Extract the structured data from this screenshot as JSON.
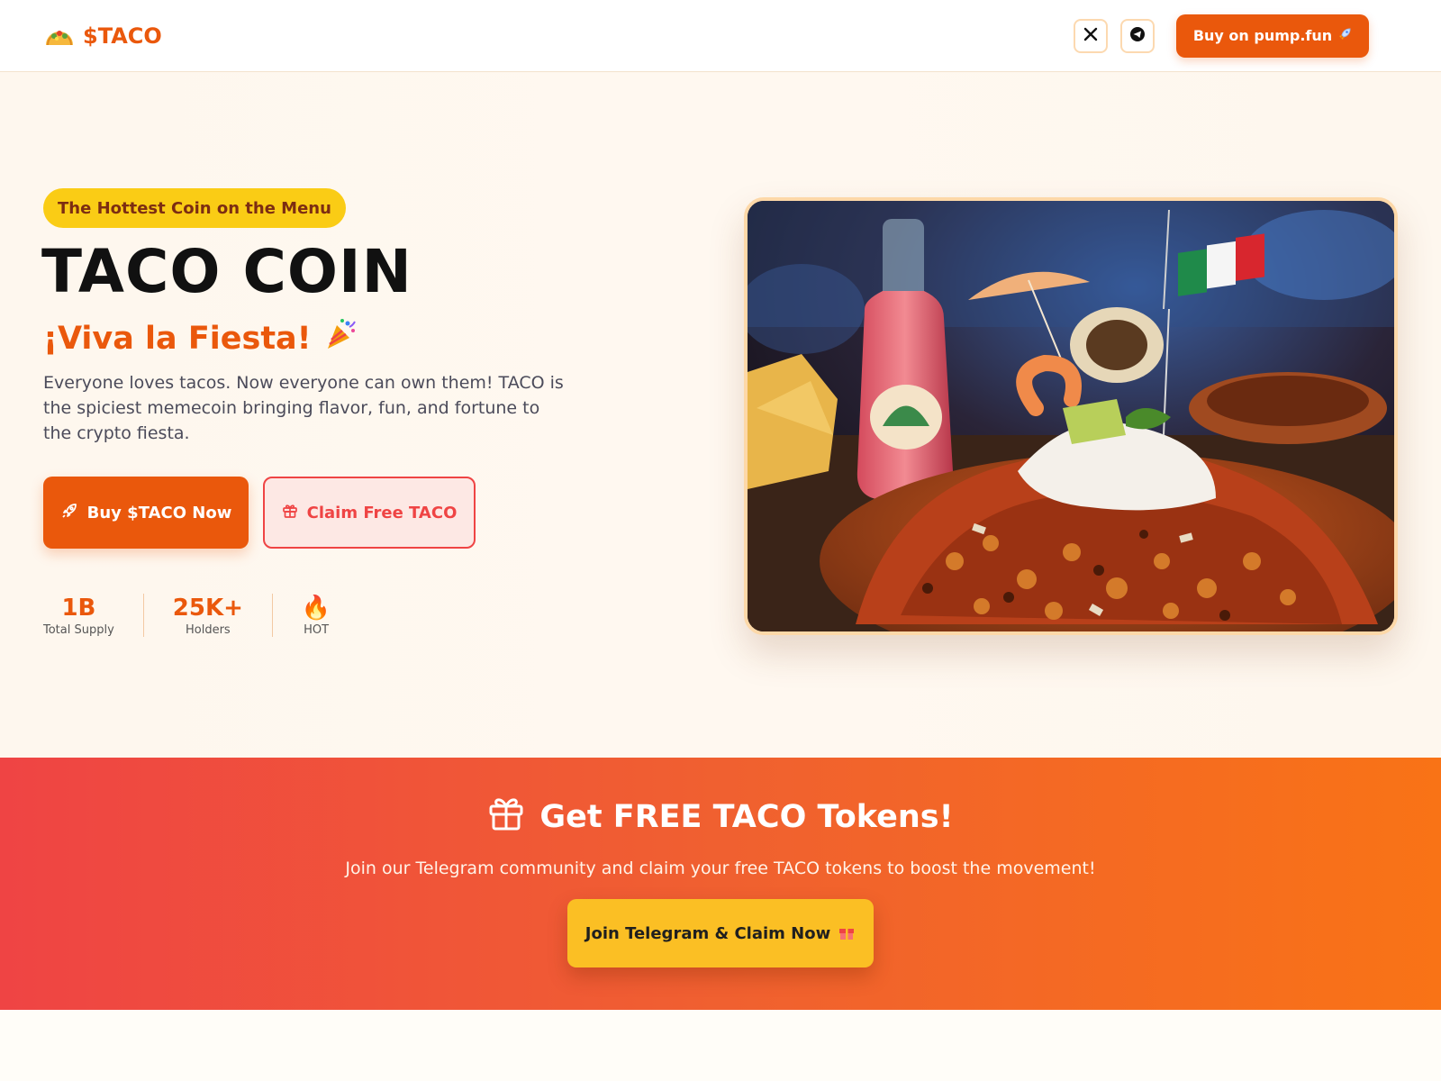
{
  "header": {
    "brand_name": "$TACO",
    "brand_icon": "taco-icon",
    "social": [
      {
        "icon": "x-icon",
        "label": "X"
      },
      {
        "icon": "telegram-icon",
        "label": "Telegram"
      }
    ],
    "buy_label": "Buy on pump.fun",
    "buy_icon": "rocket-icon"
  },
  "hero": {
    "tagline": "The Hottest Coin on the Menu",
    "title": "TACO COIN",
    "subtitle": "¡Viva la Fiesta!",
    "subtitle_icon": "party-popper-icon",
    "description": "Everyone loves tacos. Now everyone can own them! TACO is the spiciest memecoin bringing flavor, fun, and fortune to the crypto fiesta.",
    "primary_button": {
      "label": "Buy $TACO Now",
      "icon": "rocket-icon"
    },
    "secondary_button": {
      "label": "Claim Free TACO",
      "icon": "gift-icon"
    },
    "stats": [
      {
        "value": "1B",
        "label": "Total Supply"
      },
      {
        "value": "25K+",
        "label": "Holders"
      },
      {
        "value": "🔥",
        "label": "HOT"
      }
    ],
    "image_icon": "food-photo"
  },
  "promo": {
    "title": "Get FREE TACO Tokens!",
    "title_icon": "gift-icon",
    "description": "Join our Telegram community and claim your free TACO tokens to boost the movement!",
    "button_label": "Join Telegram & Claim Now",
    "button_icon": "gift-icon"
  },
  "colors": {
    "accent": "#ea580c",
    "highlight": "#facc15",
    "promo_start": "#ef4444",
    "promo_end": "#f97316",
    "background": "#fef7ee"
  }
}
